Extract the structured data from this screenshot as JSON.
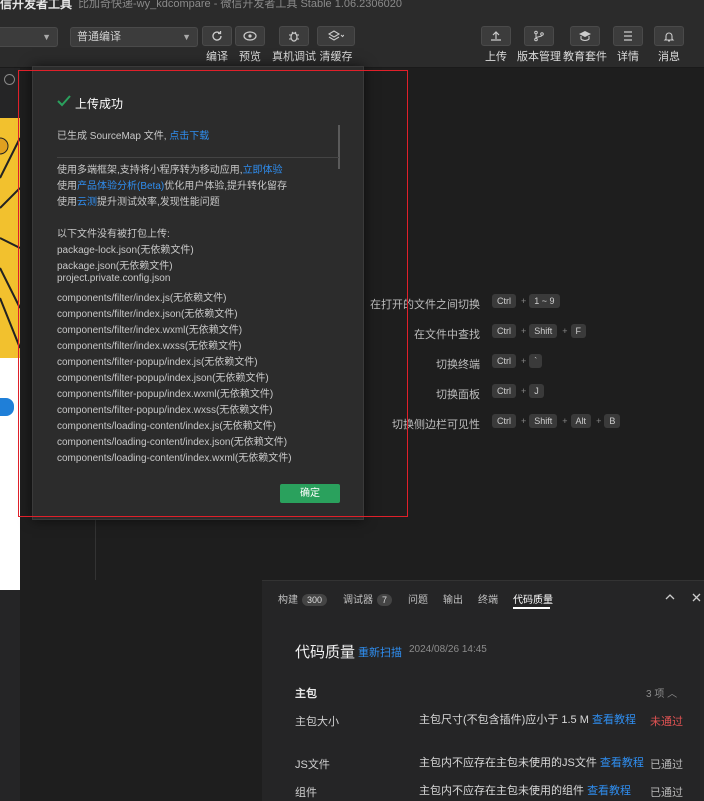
{
  "titlebar": {
    "app": "信开发者工具",
    "project": "比加奇快递-wy_kdcompare - 微信开发者工具 Stable 1.06.2306020"
  },
  "toolbar": {
    "mode_select": "普通编译",
    "buttons": [
      {
        "label": "编译",
        "icon": "refresh-icon"
      },
      {
        "label": "预览",
        "icon": "eye-icon"
      },
      {
        "label": "真机调试",
        "icon": "bug-icon"
      },
      {
        "label": "清缓存",
        "icon": "layers-icon"
      }
    ],
    "right_buttons": [
      {
        "label": "上传",
        "icon": "upload-icon"
      },
      {
        "label": "版本管理",
        "icon": "branch-icon"
      },
      {
        "label": "教育套件",
        "icon": "graduation-icon"
      },
      {
        "label": "详情",
        "icon": "menu-icon"
      },
      {
        "label": "消息",
        "icon": "bell-icon"
      }
    ]
  },
  "shortcuts": [
    {
      "name": "在打开的文件之间切换",
      "keys": [
        "Ctrl",
        "1 ~ 9"
      ]
    },
    {
      "name": "在文件中查找",
      "keys": [
        "Ctrl",
        "Shift",
        "F"
      ]
    },
    {
      "name": "切换终端",
      "keys": [
        "Ctrl",
        "`"
      ]
    },
    {
      "name": "切换面板",
      "keys": [
        "Ctrl",
        "J"
      ]
    },
    {
      "name": "切换侧边栏可见性",
      "keys": [
        "Ctrl",
        "Shift",
        "Alt",
        "B"
      ]
    }
  ],
  "modal": {
    "title": "上传成功",
    "sourcemap_text": "已生成 SourceMap 文件,",
    "sourcemap_link": "点击下载",
    "lines": [
      {
        "pre": "使用多端框架,支持将小程序转为移动应用,",
        "link": "立即体验",
        "post": ""
      },
      {
        "pre": "使用",
        "link": "产品体验分析(Beta)",
        "post": "优化用户体验,提升转化留存"
      },
      {
        "pre": "使用",
        "link": "云测",
        "post": "提升测试效率,发现性能问题"
      }
    ],
    "files_header": "以下文件没有被打包上传:",
    "files": [
      "package-lock.json(无依赖文件)",
      "package.json(无依赖文件)",
      "project.private.config.json",
      "components/filter/index.js(无依赖文件)",
      "components/filter/index.json(无依赖文件)",
      "components/filter/index.wxml(无依赖文件)",
      "components/filter/index.wxss(无依赖文件)",
      "components/filter-popup/index.js(无依赖文件)",
      "components/filter-popup/index.json(无依赖文件)",
      "components/filter-popup/index.wxml(无依赖文件)",
      "components/filter-popup/index.wxss(无依赖文件)",
      "components/loading-content/index.js(无依赖文件)",
      "components/loading-content/index.json(无依赖文件)",
      "components/loading-content/index.wxml(无依赖文件)"
    ],
    "ok_label": "确定"
  },
  "panel": {
    "tabs": [
      {
        "label": "构建",
        "badge": "300"
      },
      {
        "label": "调试器",
        "badge": "7"
      },
      {
        "label": "问题",
        "badge": ""
      },
      {
        "label": "输出",
        "badge": ""
      },
      {
        "label": "终端",
        "badge": ""
      },
      {
        "label": "代码质量",
        "badge": ""
      }
    ],
    "title": "代码质量",
    "rescan": "重新扫描",
    "timestamp": "2024/08/26 14:45",
    "section": "主包",
    "section_count": "3 项",
    "rows": [
      {
        "label": "主包大小",
        "desc": "主包尺寸(不包含插件)应小于 1.5 M",
        "link": "查看教程",
        "status": "未通过",
        "status_color": "#e05252"
      },
      {
        "label": "JS文件",
        "desc": "主包内不应存在主包未使用的JS文件",
        "link": "查看教程",
        "status": "已通过",
        "status_color": "#b8b8b8"
      },
      {
        "label": "组件",
        "desc": "主包内不应存在主包未使用的组件",
        "link": "查看教程",
        "status": "已通过",
        "status_color": "#b8b8b8"
      }
    ]
  },
  "colors": {
    "accent_link": "#2f8ef0",
    "ok_green": "#2aa15d",
    "fail_red": "#e05252",
    "highlight_frame": "#e0202a"
  }
}
